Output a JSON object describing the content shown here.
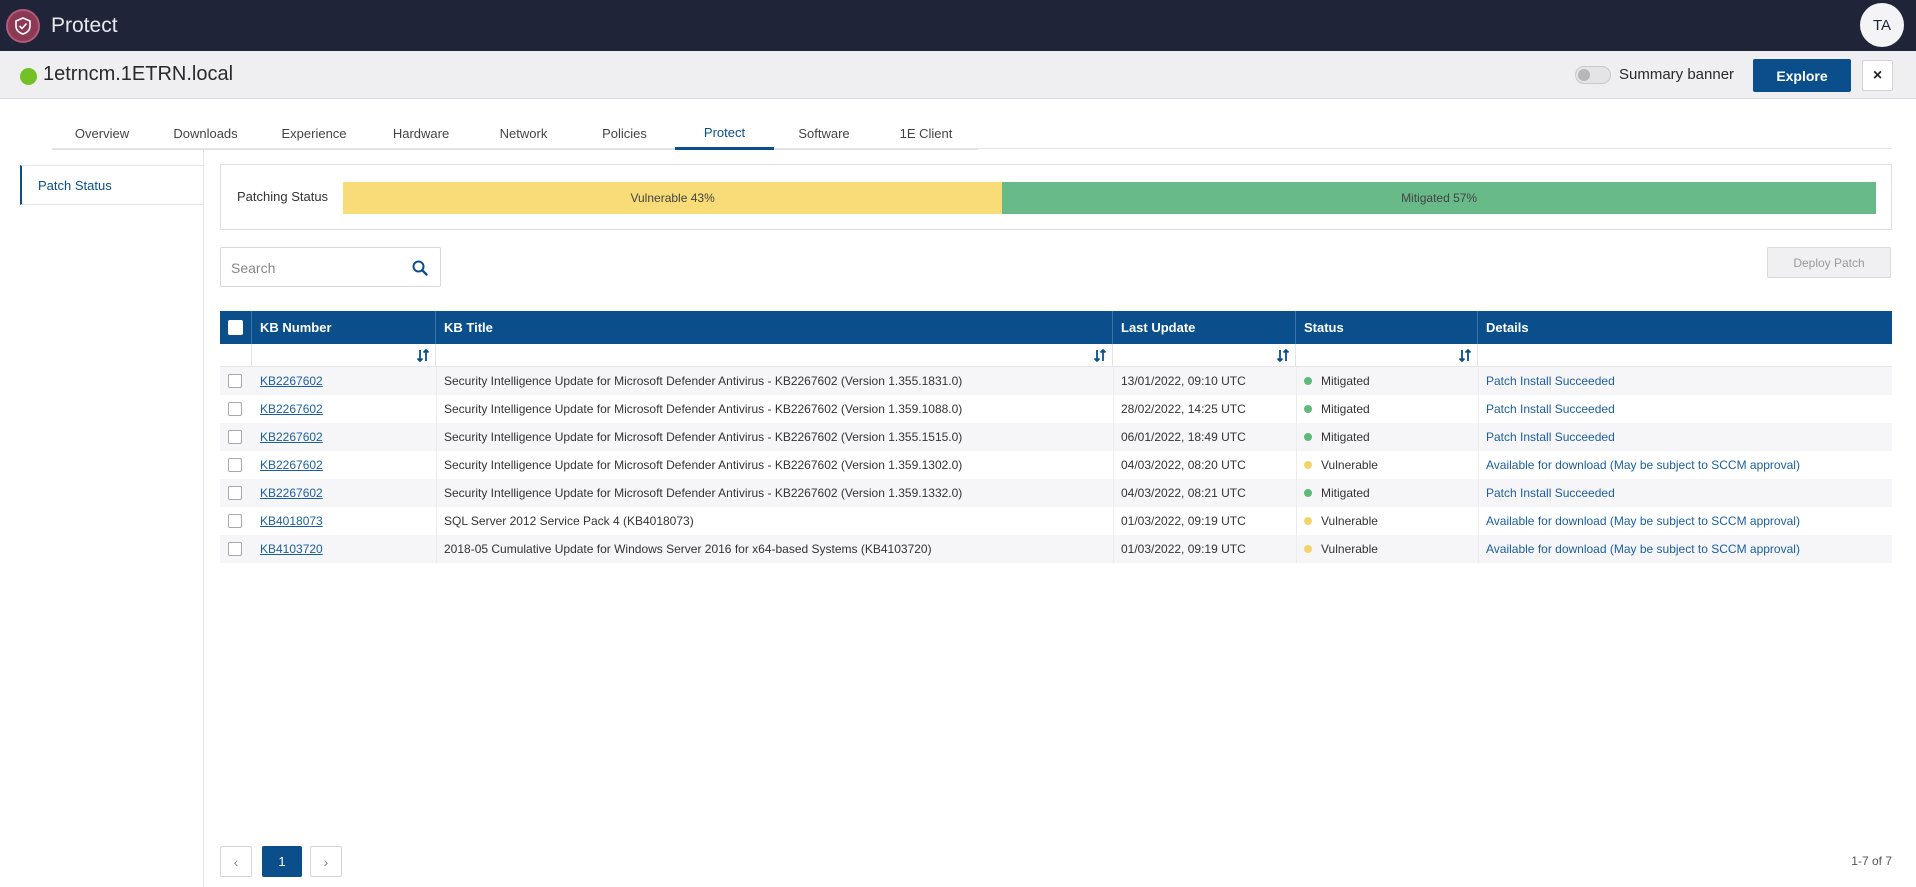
{
  "app": {
    "title": "Protect",
    "user_initials": "TA"
  },
  "device": {
    "name": "1etrncm.1ETRN.local",
    "status_color": "#74c126"
  },
  "header_actions": {
    "toggle_label": "Summary banner",
    "explore_label": "Explore",
    "close_label": "×"
  },
  "tabs": [
    {
      "label": "Overview",
      "active": false
    },
    {
      "label": "Downloads",
      "active": false
    },
    {
      "label": "Experience",
      "active": false
    },
    {
      "label": "Hardware",
      "active": false
    },
    {
      "label": "Network",
      "active": false
    },
    {
      "label": "Policies",
      "active": false
    },
    {
      "label": "Protect",
      "active": true
    },
    {
      "label": "Software",
      "active": false
    },
    {
      "label": "1E Client",
      "active": false
    }
  ],
  "sidebar": {
    "items": [
      {
        "label": "Patch Status",
        "active": true
      }
    ]
  },
  "patching": {
    "label": "Patching Status",
    "segments": [
      {
        "label": "Vulnerable 43%",
        "percent": 43,
        "color": "#f8dc77"
      },
      {
        "label": "Mitigated 57%",
        "percent": 57,
        "color": "#68ba89"
      }
    ]
  },
  "search": {
    "placeholder": "Search",
    "value": ""
  },
  "deploy_button": {
    "label": "Deploy Patch",
    "disabled": true
  },
  "table": {
    "columns": [
      "KB Number",
      "KB Title",
      "Last Update",
      "Status",
      "Details"
    ],
    "rows": [
      {
        "kb": "KB2267602",
        "title": "Security Intelligence Update for Microsoft Defender Antivirus - KB2267602 (Version 1.355.1831.0)",
        "last_update": "13/01/2022, 09:10 UTC",
        "status": "Mitigated",
        "details": "Patch Install Succeeded"
      },
      {
        "kb": "KB2267602",
        "title": "Security Intelligence Update for Microsoft Defender Antivirus - KB2267602 (Version 1.359.1088.0)",
        "last_update": "28/02/2022, 14:25 UTC",
        "status": "Mitigated",
        "details": "Patch Install Succeeded"
      },
      {
        "kb": "KB2267602",
        "title": "Security Intelligence Update for Microsoft Defender Antivirus - KB2267602 (Version 1.355.1515.0)",
        "last_update": "06/01/2022, 18:49 UTC",
        "status": "Mitigated",
        "details": "Patch Install Succeeded"
      },
      {
        "kb": "KB2267602",
        "title": "Security Intelligence Update for Microsoft Defender Antivirus - KB2267602 (Version 1.359.1302.0)",
        "last_update": "04/03/2022, 08:20 UTC",
        "status": "Vulnerable",
        "details": "Available for download (May be subject to SCCM approval)"
      },
      {
        "kb": "KB2267602",
        "title": "Security Intelligence Update for Microsoft Defender Antivirus - KB2267602 (Version 1.359.1332.0)",
        "last_update": "04/03/2022, 08:21 UTC",
        "status": "Mitigated",
        "details": "Patch Install Succeeded"
      },
      {
        "kb": "KB4018073",
        "title": "SQL Server 2012 Service Pack 4 (KB4018073)",
        "last_update": "01/03/2022, 09:19 UTC",
        "status": "Vulnerable",
        "details": "Available for download (May be subject to SCCM approval)"
      },
      {
        "kb": "KB4103720",
        "title": "2018-05 Cumulative Update for Windows Server 2016 for x64-based Systems (KB4103720)",
        "last_update": "01/03/2022, 09:19 UTC",
        "status": "Vulnerable",
        "details": "Available for download (May be subject to SCCM approval)"
      }
    ]
  },
  "pagination": {
    "prev": "‹",
    "current": "1",
    "next": "›",
    "summary": "1-7 of 7"
  },
  "colors": {
    "brand": "#0a4f8c",
    "topbar": "#1f2438",
    "mitigated": "#5dba7a",
    "vulnerable": "#f1d56a"
  }
}
